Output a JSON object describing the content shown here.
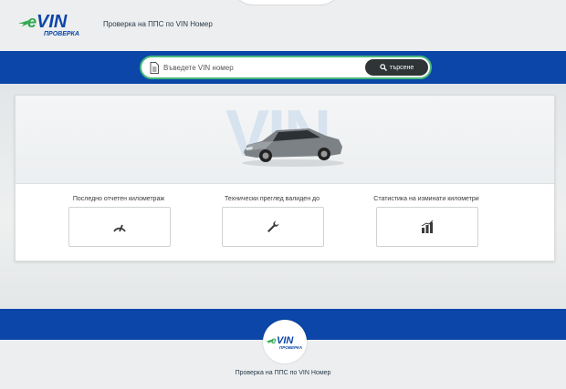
{
  "header": {
    "logo_text": "VIN",
    "logo_subtext": "ПРОВЕРКА",
    "tagline": "Проверка на ППС по VIN Номер"
  },
  "search": {
    "placeholder": "Въведете VIN номер",
    "button_label": "търсене"
  },
  "hero": {
    "watermark": "VIN"
  },
  "stats": [
    {
      "label": "Последно отчетен километраж",
      "icon": "gauge-icon"
    },
    {
      "label": "Технически преглед валиден до",
      "icon": "wrench-icon"
    },
    {
      "label": "Статистика на изминати километри",
      "icon": "bar-chart-icon"
    }
  ],
  "footer": {
    "logo_text": "VIN",
    "logo_subtext": "ПРОВЕРКА",
    "tagline": "Проверка на ППС по VIN Номер"
  },
  "colors": {
    "brand_blue": "#0b46a8",
    "logo_green": "#2ea84f",
    "button_dark": "#2f3436"
  }
}
